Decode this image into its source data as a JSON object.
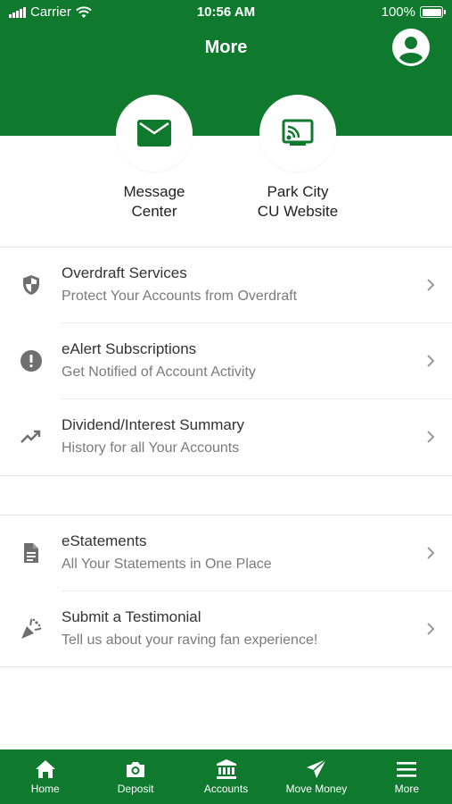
{
  "status_bar": {
    "carrier": "Carrier",
    "time": "10:56 AM",
    "battery": "100%"
  },
  "header": {
    "title": "More",
    "profile_icon": "account-circle-icon"
  },
  "quick_actions": [
    {
      "icon": "mail-icon",
      "line1": "Message",
      "line2": "Center"
    },
    {
      "icon": "cast-icon",
      "line1": "Park City",
      "line2": "CU Website"
    }
  ],
  "sections": [
    {
      "items": [
        {
          "icon": "shield-icon",
          "title": "Overdraft Services",
          "subtitle": "Protect Your Accounts from Overdraft"
        },
        {
          "icon": "alert-icon",
          "title": "eAlert Subscriptions",
          "subtitle": "Get Notified of Account Activity"
        },
        {
          "icon": "trending-up-icon",
          "title": "Dividend/Interest Summary",
          "subtitle": "History for all Your Accounts"
        }
      ]
    },
    {
      "items": [
        {
          "icon": "document-icon",
          "title": "eStatements",
          "subtitle": "All Your Statements in One Place"
        },
        {
          "icon": "party-popper-icon",
          "title": "Submit a Testimonial",
          "subtitle": "Tell us about your raving fan experience!"
        }
      ]
    }
  ],
  "tab_bar": {
    "tabs": [
      {
        "icon": "home-icon",
        "label": "Home"
      },
      {
        "icon": "camera-icon",
        "label": "Deposit"
      },
      {
        "icon": "bank-icon",
        "label": "Accounts"
      },
      {
        "icon": "send-icon",
        "label": "Move Money"
      },
      {
        "icon": "menu-icon",
        "label": "More"
      }
    ],
    "selected": "More"
  },
  "colors": {
    "brand_green": "#0f7a2e",
    "icon_gray": "#6f6f6f"
  }
}
